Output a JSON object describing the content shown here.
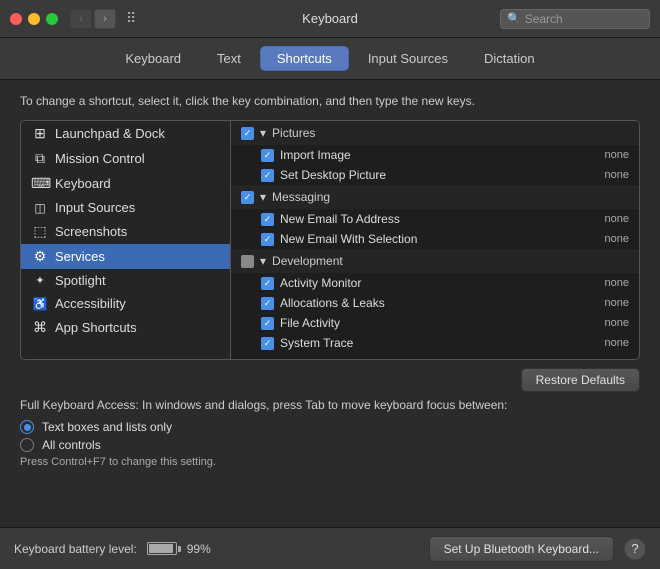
{
  "titlebar": {
    "title": "Keyboard",
    "search_placeholder": "Search"
  },
  "tabs": [
    {
      "id": "keyboard",
      "label": "Keyboard",
      "active": false
    },
    {
      "id": "text",
      "label": "Text",
      "active": false
    },
    {
      "id": "shortcuts",
      "label": "Shortcuts",
      "active": true
    },
    {
      "id": "input-sources",
      "label": "Input Sources",
      "active": false
    },
    {
      "id": "dictation",
      "label": "Dictation",
      "active": false
    }
  ],
  "instruction": "To change a shortcut, select it, click the key combination, and then type the new keys.",
  "sidebar": {
    "items": [
      {
        "id": "launchpad",
        "icon": "⊞",
        "label": "Launchpad & Dock",
        "selected": false
      },
      {
        "id": "mission-control",
        "icon": "⧉",
        "label": "Mission Control",
        "selected": false
      },
      {
        "id": "keyboard",
        "icon": "⌨",
        "label": "Keyboard",
        "selected": false
      },
      {
        "id": "input-sources",
        "icon": "◫",
        "label": "Input Sources",
        "selected": false
      },
      {
        "id": "screenshots",
        "icon": "⬚",
        "label": "Screenshots",
        "selected": false
      },
      {
        "id": "services",
        "icon": "⚙",
        "label": "Services",
        "selected": true
      },
      {
        "id": "spotlight",
        "icon": "✦",
        "label": "Spotlight",
        "selected": false
      },
      {
        "id": "accessibility",
        "icon": "♿",
        "label": "Accessibility",
        "selected": false
      },
      {
        "id": "app-shortcuts",
        "icon": "⌘",
        "label": "App Shortcuts",
        "selected": false
      }
    ]
  },
  "shortcuts": {
    "sections": [
      {
        "id": "pictures",
        "label": "Pictures",
        "checked": true,
        "partial": false,
        "items": [
          {
            "label": "Import Image",
            "key": "none",
            "checked": true
          },
          {
            "label": "Set Desktop Picture",
            "key": "none",
            "checked": true
          }
        ]
      },
      {
        "id": "messaging",
        "label": "Messaging",
        "checked": true,
        "partial": false,
        "items": [
          {
            "label": "New Email To Address",
            "key": "none",
            "checked": true
          },
          {
            "label": "New Email With Selection",
            "key": "none",
            "checked": true
          }
        ]
      },
      {
        "id": "development",
        "label": "Development",
        "checked": false,
        "partial": true,
        "items": [
          {
            "label": "Activity Monitor",
            "key": "none",
            "checked": true
          },
          {
            "label": "Allocations & Leaks",
            "key": "none",
            "checked": true
          },
          {
            "label": "File Activity",
            "key": "none",
            "checked": true
          },
          {
            "label": "System Trace",
            "key": "none",
            "checked": true
          }
        ]
      }
    ]
  },
  "restore_defaults_label": "Restore Defaults",
  "fka": {
    "title": "Full Keyboard Access: In windows and dialogs, press Tab to move keyboard focus between:",
    "options": [
      {
        "id": "text-boxes",
        "label": "Text boxes and lists only",
        "selected": true
      },
      {
        "id": "all-controls",
        "label": "All controls",
        "selected": false
      }
    ],
    "note": "Press Control+F7 to change this setting."
  },
  "bottom": {
    "battery_label": "Keyboard battery level:",
    "battery_percent": "99%",
    "setup_button": "Set Up Bluetooth Keyboard...",
    "help": "?"
  }
}
